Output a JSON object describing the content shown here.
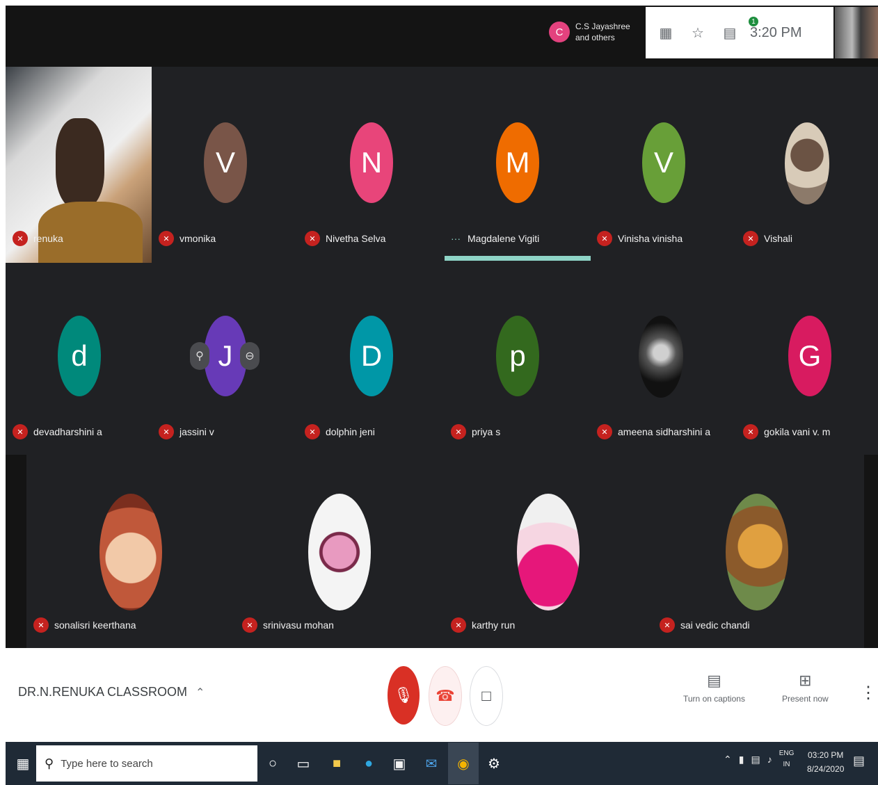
{
  "top_bar": {
    "presenter": {
      "initial": "C",
      "line1": "C.S Jayashree",
      "line2": "and others"
    },
    "icons": [
      "people-icon",
      "activities-icon",
      "chat-icon"
    ],
    "chat_badge": "1",
    "clock": "3:20 PM"
  },
  "tiles": [
    {
      "name": "renuka",
      "type": "video"
    },
    {
      "name": "vmonika",
      "initial": "V",
      "color": "#795548"
    },
    {
      "name": "Nivetha Selva",
      "initial": "N",
      "color": "#e8457a"
    },
    {
      "name": "Magdalene Vigiti",
      "initial": "M",
      "color": "#ef6c00",
      "speaking": true
    },
    {
      "name": "Vinisha vinisha",
      "initial": "V",
      "color": "#689f38"
    },
    {
      "name": "Vishali",
      "type": "photo"
    },
    {
      "name": "devadharshini a",
      "initial": "d",
      "color": "#00897b"
    },
    {
      "name": "jassini v",
      "initial": "J",
      "color": "#673ab7"
    },
    {
      "name": "dolphin jeni",
      "initial": "D",
      "color": "#0097a7"
    },
    {
      "name": "priya s",
      "initial": "p",
      "color": "#33691e"
    },
    {
      "name": "ameena sidharshini a",
      "type": "photo"
    },
    {
      "name": "gokila vani v. m",
      "initial": "G",
      "color": "#d81b60"
    },
    {
      "name": "sonalisri keerthana",
      "type": "photo"
    },
    {
      "name": "srinivasu mohan",
      "type": "photo"
    },
    {
      "name": "karthy run",
      "type": "photo"
    },
    {
      "name": "sai vedic chandi",
      "type": "photo"
    }
  ],
  "bottom_bar": {
    "meeting_title": "DR.N.RENUKA CLASSROOM",
    "captions_label": "Turn on captions",
    "present_label": "Present now"
  },
  "taskbar": {
    "search_placeholder": "Type here to search",
    "tray_lang_line1": "ENG",
    "tray_lang_line2": "IN",
    "tray_time": "03:20 PM",
    "tray_date": "8/24/2020"
  },
  "colors": {
    "grid_bg": "#202124",
    "speaking_bar": "#8ed4c6",
    "mic_off": "#d93025",
    "taskbar": "#1f2a36"
  }
}
